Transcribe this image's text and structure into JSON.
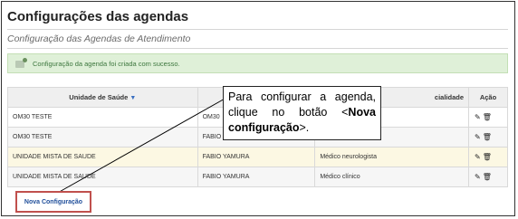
{
  "page": {
    "title": "Configurações das agendas",
    "subtitle": "Configuração das Agendas de Atendimento"
  },
  "alert": {
    "message": "Configuração da agenda foi criada com sucesso.",
    "icon": "alert-icon"
  },
  "table": {
    "columns": [
      "Unidade de Saúde",
      "",
      "Especialidade",
      "Ação"
    ],
    "columns_visible": [
      "Unidade de Saúde",
      "cialidade",
      "Ação"
    ],
    "rows": [
      {
        "unidade": "OM30 TESTE",
        "profissional": "OM30",
        "especialidade": ""
      },
      {
        "unidade": "OM30 TESTE",
        "profissional": "FABIO",
        "especialidade": ""
      },
      {
        "unidade": "UNIDADE MISTA DE SAUDE",
        "profissional": "FABIO YAMURA",
        "especialidade": "Médico neurologista"
      },
      {
        "unidade": "UNIDADE MISTA DE SAUDE",
        "profissional": "FABIO YAMURA",
        "especialidade": "Médico clínico"
      }
    ],
    "action_icons": [
      "edit-icon",
      "trash-icon"
    ]
  },
  "button": {
    "nova_configuracao": "Nova Configuração"
  },
  "callout": {
    "line1": "Para configurar a agenda, clique no botão <",
    "bold": "Nova configuração",
    "end": ">."
  }
}
